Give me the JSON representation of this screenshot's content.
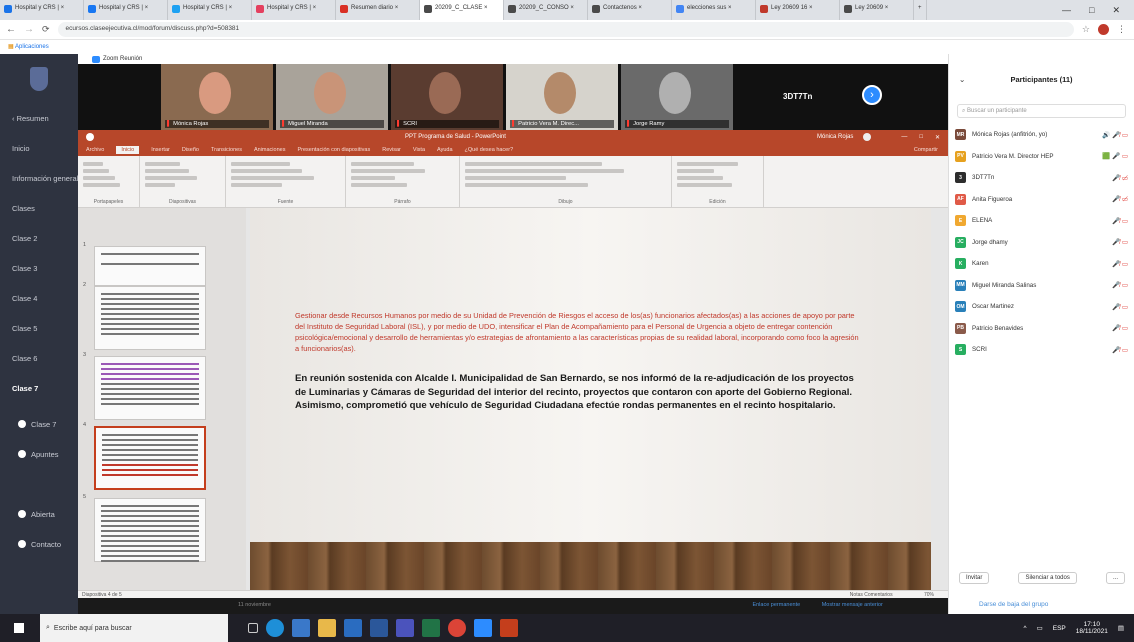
{
  "browser": {
    "tabs": [
      {
        "label": "Hospital y CRS | ×",
        "color": "#1a73e8"
      },
      {
        "label": "Hospital y CRS | ×",
        "color": "#1877f2"
      },
      {
        "label": "Hospital y CRS | ×",
        "color": "#1da1f2"
      },
      {
        "label": "Hospital y CRS | ×",
        "color": "#e4405f"
      },
      {
        "label": "Resumen diario ×",
        "color": "#d93025"
      },
      {
        "label": "20209_C_CLASE ×",
        "color": "#4a4a4a"
      },
      {
        "label": "20209_C_CONSO ×",
        "color": "#4a4a4a"
      },
      {
        "label": "Contactenos ×",
        "color": "#4a4a4a"
      },
      {
        "label": "elecciones sus ×",
        "color": "#4285f4"
      },
      {
        "label": "Ley 20609 16 × ",
        "color": "#c0392b"
      },
      {
        "label": "Ley 20609 ×",
        "color": "#4a4a4a"
      }
    ],
    "new_tab": "+",
    "url": "ecursos.claseejecutiva.cl/mod/forum/discuss.php?d=508381",
    "bookmarks_label": "Aplicaciones",
    "window_min": "—",
    "window_max": "□",
    "window_close": "✕"
  },
  "moodle_nav": {
    "items": [
      {
        "label": "Resumen",
        "highlight": false
      },
      {
        "label": "Inicio",
        "highlight": false
      },
      {
        "label": "Información general",
        "highlight": false
      },
      {
        "label": "Clases",
        "highlight": false
      },
      {
        "label": "Clase 2",
        "highlight": false
      },
      {
        "label": "Clase 3",
        "highlight": false
      },
      {
        "label": "Clase 4",
        "highlight": false
      },
      {
        "label": "Clase 5",
        "highlight": false
      },
      {
        "label": "Clase 6",
        "highlight": false
      },
      {
        "label": "Clase 7",
        "highlight": true
      }
    ],
    "subitems": [
      "Clase 7",
      "Apuntes",
      "Abierta",
      "Contacto"
    ]
  },
  "zoom": {
    "window_title": "Zoom Reunión",
    "participants_videos": [
      {
        "name": "Mónica Rojas",
        "skin": "#d99a80",
        "bg": "#8a6a50"
      },
      {
        "name": "Miguel Miranda",
        "skin": "#c99478",
        "bg": "#a9a39a"
      },
      {
        "name": "SCRI",
        "skin": "#9a6a55",
        "bg": "#5a3c30"
      },
      {
        "name": "Patricio Vera M. Direc...",
        "skin": "#b48a6a",
        "bg": "#d6d3cc"
      },
      {
        "name": "Jorge Ramy",
        "skin": "#b0b0b0",
        "bg": "#6a6a6a"
      }
    ],
    "active_speaker": "3DT7Tn",
    "next_arrow": "›",
    "panel": {
      "title": "Participantes (11)",
      "search_placeholder": "Buscar un participante",
      "participants": [
        {
          "name": "Mónica Rojas (anfitrión, yo)",
          "initials": "MR",
          "color": "#7a4a3a",
          "icons": "🔊 🎤̸ ▭"
        },
        {
          "name": "Patricio Vera M. Director HEP",
          "initials": "PV",
          "color": "#e6a11f",
          "icons": "🟩 🎤 ▭"
        },
        {
          "name": "3DT7Tn",
          "initials": "3",
          "color": "#2d2d2d",
          "icons": "🎤̸ ▭̸"
        },
        {
          "name": "Anita Figueroa",
          "initials": "AF",
          "color": "#e05a47",
          "icons": "🎤̸ ▭̸"
        },
        {
          "name": "ELENA",
          "initials": "E",
          "color": "#f0a830",
          "icons": "🎤̸ ▭"
        },
        {
          "name": "Jorge dhamy",
          "initials": "JC",
          "color": "#27ae60",
          "icons": "🎤̸ ▭"
        },
        {
          "name": "Karen",
          "initials": "K",
          "color": "#27ae60",
          "icons": "🎤̸ ▭"
        },
        {
          "name": "Miguel Miranda Salinas",
          "initials": "MM",
          "color": "#2980b9",
          "icons": "🎤̸ ▭"
        },
        {
          "name": "Oscar Martinez",
          "initials": "OM",
          "color": "#2980b9",
          "icons": "🎤̸ ▭"
        },
        {
          "name": "Patricio Benavides",
          "initials": "PB",
          "color": "#8a5a4a",
          "icons": "🎤̸ ▭"
        },
        {
          "name": "SCRI",
          "initials": "S",
          "color": "#27ae60",
          "icons": "🎤̸ ▭"
        }
      ],
      "invite": "Invitar",
      "mute_all": "Silenciar a todos",
      "more": "...",
      "leave_group": "Darse de baja del grupo"
    }
  },
  "powerpoint": {
    "title": "PPT Programa de Salud - PowerPoint",
    "user": "Mónica Rojas",
    "share": "Compartir",
    "tabs": [
      "Archivo",
      "Inicio",
      "Insertar",
      "Diseño",
      "Transiciones",
      "Animaciones",
      "Presentación con diapositivas",
      "Revisar",
      "Vista",
      "Ayuda",
      "¿Qué desea hacer?"
    ],
    "ribbon_groups": [
      "Portapapeles",
      "Diapositivas",
      "Fuente",
      "Párrafo",
      "Dibujo",
      "Edición"
    ],
    "slide_numbers": [
      "1",
      "2",
      "3",
      "4",
      "5"
    ],
    "slide_text_red": "Gestionar desde Recursos Humanos por medio de su Unidad de Prevención de Riesgos el acceso de los(as) funcionarios afectados(as) a las acciones de apoyo por parte del Instituto de Seguridad Laboral (ISL), y por medio de UDO, intensificar el Plan de Acompañamiento para el Personal de Urgencia a objeto de entregar contención psicológica/emocional y desarrollo de herramientas y/o estrategias de afrontamiento a las características propias de su realidad laboral, incorporando como foco la agresión a funcionarios(as).",
    "slide_text_black": "En reunión sostenida con Alcalde I. Municipalidad de San Bernardo, se nos informó de la re-adjudicación de los proyectos de Luminarias y Cámaras de Seguridad del interior del recinto, proyectos que contaron con aporte del Gobierno Regional. Asimismo, comprometió que vehículo de Seguridad Ciudadana efectúe rondas permanentes en el recinto hospitalario.",
    "status_left": "Diapositiva 4 de 5",
    "status_right": "Notas   Comentarios",
    "zoom_level": "70%"
  },
  "below": {
    "time_hint": "11 noviembre",
    "link1": "Enlace permanente",
    "link2": "Mostrar mensaje anterior"
  },
  "taskbar": {
    "search_placeholder": "Escribe aquí para buscar",
    "time": "17:10",
    "date": "18/11/2021",
    "lang": "ESP"
  }
}
